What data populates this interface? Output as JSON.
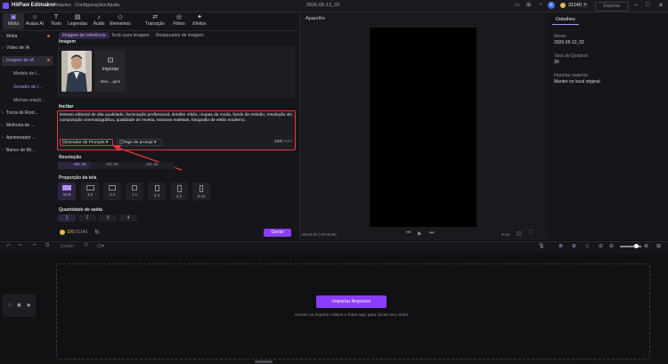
{
  "titlebar": {
    "app_name": "HitPaw Edimakor",
    "menus": [
      "Arquivo",
      "Configurações",
      "Ajuda"
    ],
    "document": "2026-05-12_02",
    "avatar_letter": "E",
    "credits": "31140",
    "export_label": "Exportar"
  },
  "toolbar": {
    "tools": [
      {
        "label": "Mídia",
        "icon": "media-icon"
      },
      {
        "label": "Avatar AI",
        "icon": "avatar-icon"
      },
      {
        "label": "Texto",
        "icon": "text-icon"
      },
      {
        "label": "Legendas",
        "icon": "subtitles-icon"
      },
      {
        "label": "Áudio",
        "icon": "audio-icon"
      },
      {
        "label": "Elementos",
        "icon": "elements-icon"
      },
      {
        "label": "Transição",
        "icon": "transition-icon"
      },
      {
        "label": "Filtros",
        "icon": "filters-icon"
      },
      {
        "label": "Efeitos",
        "icon": "effects-icon"
      }
    ]
  },
  "sidebar": {
    "items": [
      {
        "label": "Mídia"
      },
      {
        "label": "Vídeo de IA"
      },
      {
        "label": "Imagem de IA"
      }
    ],
    "subitems": [
      "Modelo de I...",
      "Gerador de I...",
      "Minhas criaçõ..."
    ],
    "items_after": [
      {
        "label": "Troca de Rost..."
      },
      {
        "label": "Melhoria de ..."
      },
      {
        "label": "Aprimorador ..."
      },
      {
        "label": "Banco de Mí..."
      }
    ]
  },
  "main": {
    "subtabs": [
      "Imagem de referência",
      "Texto para imagem",
      "Restaurador de imagem"
    ],
    "image_section_label": "Imagem",
    "import_label": "Importar",
    "import_sub": "Meu ...gem",
    "prompt_label": "Incitar",
    "prompt_text": "Retrato editorial de alta qualidade, iluminação profissional, detalhe nítido, roupas da moda, fundo de estúdio, resolução 4K, composição cinematográfica, qualidade de revista, texturas realistas, fotografia de estilo moderno.",
    "prompt_generator_label": "Gerador de Prompts",
    "prompt_tags_label": "Tags de prompt",
    "char_count": "228",
    "char_max": "/2000",
    "resolution_label": "Resolução",
    "resolutions": [
      "HD 1K",
      "HD 2K",
      "HD 4K"
    ],
    "ratio_label": "Proporção da tela",
    "ratios": [
      "16:9",
      "3:2",
      "4:3",
      "1:1",
      "3:4",
      "2:3",
      "9:16"
    ],
    "quantity_label": "Quantidade de saída",
    "quantities": [
      "1",
      "2",
      "3",
      "4"
    ],
    "cost": "100",
    "cost_max": "/31140",
    "generate_label": "Gerar"
  },
  "player": {
    "title": "Aparelho",
    "timecode": "00:00:00 | 00:00:00",
    "ratio_readout": "9:16"
  },
  "details": {
    "tab": "Detalhes",
    "fields": [
      {
        "label": "Nome",
        "value": "2026-05-12_02"
      },
      {
        "label": "Taxa de Quadros",
        "value": "30"
      },
      {
        "label": "Importar material",
        "value": "Manter no local original"
      }
    ]
  },
  "timeline": {
    "delete_label": "Excluir",
    "import_button": "Importar Arquivos",
    "hint": "Arraste ou importe vídeos e fotos aqui para iniciar seu vídeo."
  },
  "colors": {
    "accent": "#8b3dff",
    "accent_light": "#b48cff",
    "highlight_red": "#e0373d",
    "coin": "#e4b94a"
  }
}
